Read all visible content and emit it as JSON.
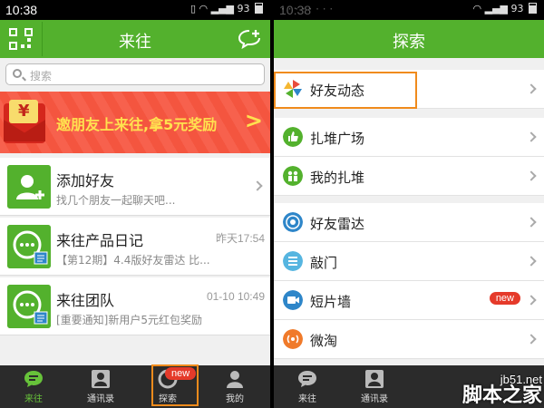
{
  "left": {
    "status": {
      "time": "10:38",
      "battery": "93"
    },
    "title": "来往",
    "search_placeholder": "搜索",
    "banner_text": "邀朋友上来往,拿5元奖励",
    "banner_arrow": ">",
    "banner_symbol": "¥",
    "rows": [
      {
        "title": "添加好友",
        "subtitle": "找几个朋友一起聊天吧..."
      },
      {
        "title": "来往产品日记",
        "time": "昨天17:54",
        "subtitle": "【第12期】4.4版好友雷达 比..."
      },
      {
        "title": "来往团队",
        "time": "01-10 10:49",
        "subtitle": "[重要通知]新用户5元红包奖励"
      }
    ],
    "tabs": [
      {
        "label": "来往",
        "icon": "chat-bubble-icon"
      },
      {
        "label": "通讯录",
        "icon": "contacts-icon"
      },
      {
        "label": "探索",
        "icon": "explore-icon",
        "badge": "new"
      },
      {
        "label": "我的",
        "icon": "profile-icon"
      }
    ]
  },
  "right": {
    "status": {
      "time": "10:38",
      "battery": "93"
    },
    "title": "探索",
    "items": [
      {
        "label": "好友动态",
        "icon": "pinwheel-icon"
      },
      {
        "label": "扎堆广场",
        "icon": "thumbs-up-icon"
      },
      {
        "label": "我的扎堆",
        "icon": "group-icon"
      },
      {
        "label": "好友雷达",
        "icon": "radar-icon"
      },
      {
        "label": "敲门",
        "icon": "door-icon"
      },
      {
        "label": "短片墙",
        "icon": "video-icon",
        "badge": "new"
      },
      {
        "label": "微淘",
        "icon": "broadcast-icon"
      }
    ],
    "tabs": [
      {
        "label": "来往",
        "icon": "chat-bubble-icon"
      },
      {
        "label": "通讯录",
        "icon": "contacts-icon"
      }
    ]
  },
  "watermark": {
    "site": "jb51.net",
    "brand": "脚本之家"
  },
  "colors": {
    "brand_green": "#53b12d",
    "banner_red": "#f4553f",
    "highlight_orange": "#f08b1c",
    "badge_red": "#e53a2a"
  }
}
